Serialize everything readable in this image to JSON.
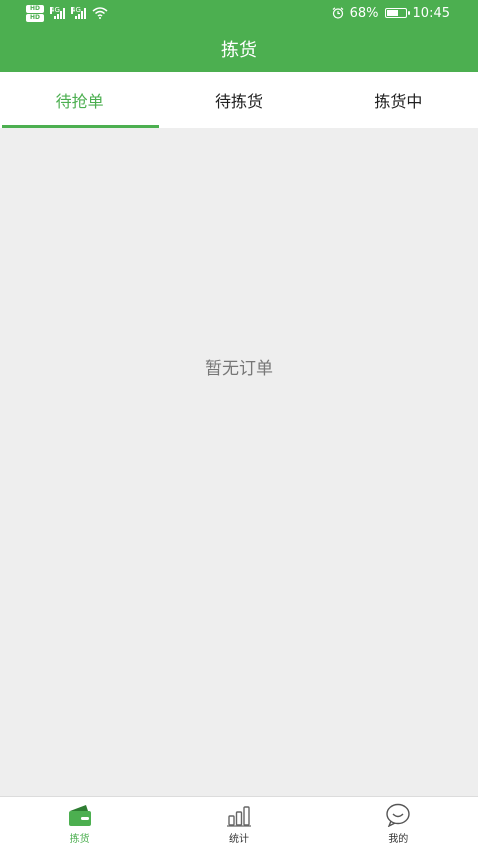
{
  "status_bar": {
    "sim1_badge": "HD",
    "sim2_badge": "HD",
    "net1": "4G",
    "net2": "4G",
    "battery_percent": "68%",
    "battery_level": 0.68,
    "time": "10:45",
    "icons": [
      "hd-icon",
      "signal-icon",
      "wifi-icon",
      "alarm-icon",
      "battery-icon"
    ]
  },
  "header": {
    "title": "拣货"
  },
  "tabs": [
    {
      "label": "待抢单",
      "active": true
    },
    {
      "label": "待拣货",
      "active": false
    },
    {
      "label": "拣货中",
      "active": false
    }
  ],
  "content": {
    "empty_text": "暂无订单"
  },
  "bottom_nav": [
    {
      "label": "拣货",
      "icon": "wallet-icon",
      "active": true
    },
    {
      "label": "统计",
      "icon": "bar-chart-icon",
      "active": false
    },
    {
      "label": "我的",
      "icon": "smiley-profile-icon",
      "active": false
    }
  ],
  "colors": {
    "primary": "#4caf50",
    "background": "#eeeeee",
    "text": "#222222",
    "muted_text": "#777777"
  }
}
